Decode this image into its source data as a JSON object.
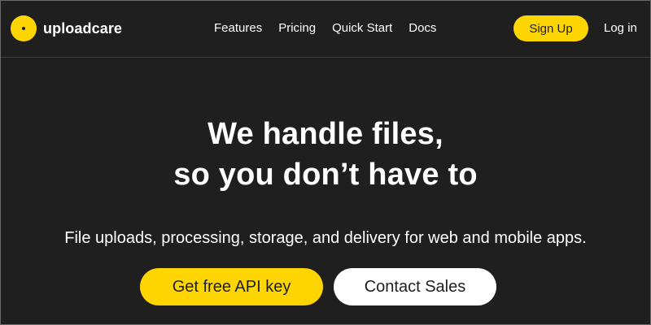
{
  "header": {
    "logo_text": "uploadcare",
    "nav": [
      {
        "label": "Features"
      },
      {
        "label": "Pricing"
      },
      {
        "label": "Quick Start"
      },
      {
        "label": "Docs"
      }
    ],
    "signup_label": "Sign Up",
    "login_label": "Log in"
  },
  "hero": {
    "title_line1": "We handle files,",
    "title_line2": "so you don’t have to",
    "subtitle": "File uploads, processing, storage, and delivery for web and mobile apps.",
    "primary_button": "Get free API key",
    "secondary_button": "Contact Sales"
  },
  "colors": {
    "background": "#1f1f1f",
    "accent": "#ffd500",
    "text": "#ffffff"
  },
  "icons": {
    "logo": "uploadcare-logo-icon"
  }
}
